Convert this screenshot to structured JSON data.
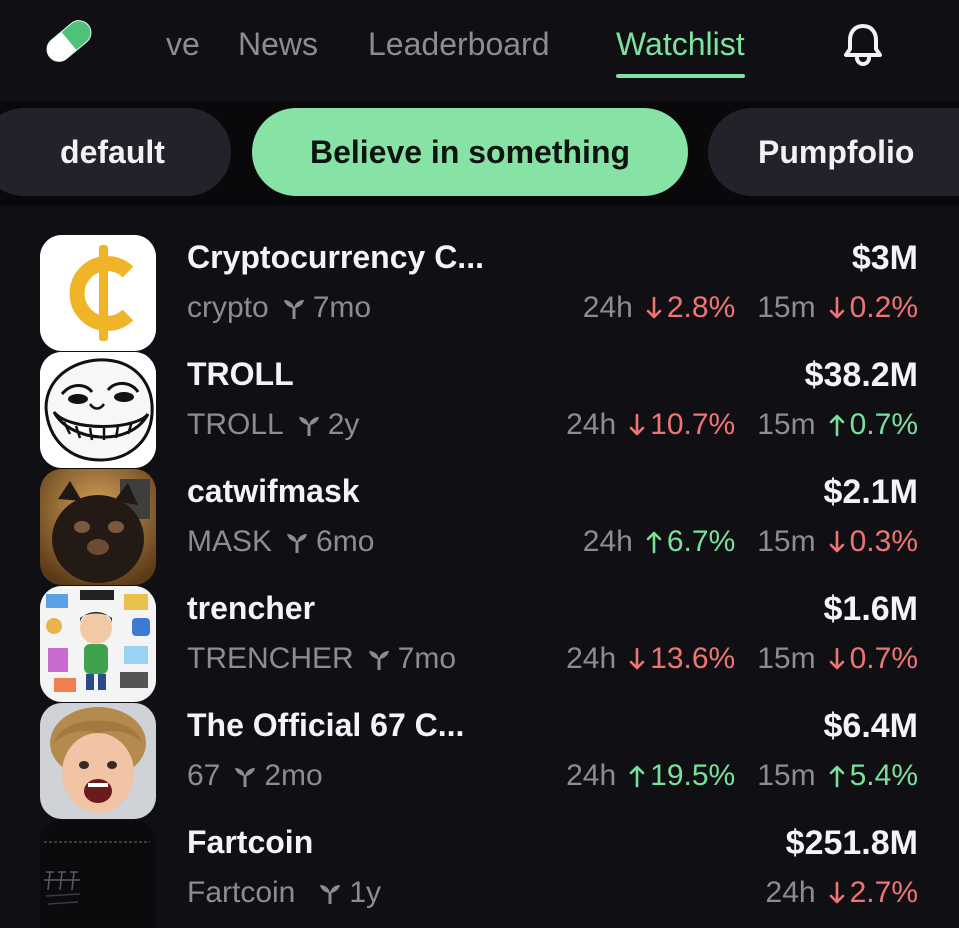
{
  "nav": {
    "tabs": [
      {
        "label": "ve"
      },
      {
        "label": "News"
      },
      {
        "label": "Leaderboard"
      },
      {
        "label": "Watchlist",
        "active": true
      }
    ]
  },
  "lists": {
    "pills": [
      {
        "label": "default"
      },
      {
        "label": "Believe in something",
        "active": true
      },
      {
        "label": "Pumpfolio"
      }
    ]
  },
  "coins": [
    {
      "name": "Cryptocurrency C...",
      "ticker": "crypto",
      "age": "7mo",
      "market_cap": "$3M",
      "change_24h": {
        "label": "24h",
        "value": "2.8%",
        "direction": "down"
      },
      "change_15m": {
        "label": "15m",
        "value": "0.2%",
        "direction": "down"
      },
      "avatar": "bitcoin-cent-logo"
    },
    {
      "name": "TROLL",
      "ticker": "TROLL",
      "age": "2y",
      "market_cap": "$38.2M",
      "change_24h": {
        "label": "24h",
        "value": "10.7%",
        "direction": "down"
      },
      "change_15m": {
        "label": "15m",
        "value": "0.7%",
        "direction": "up"
      },
      "avatar": "trollface"
    },
    {
      "name": "catwifmask",
      "ticker": "MASK",
      "age": "6mo",
      "market_cap": "$2.1M",
      "change_24h": {
        "label": "24h",
        "value": "6.7%",
        "direction": "up"
      },
      "change_15m": {
        "label": "15m",
        "value": "0.3%",
        "direction": "down"
      },
      "avatar": "cat-with-mask-photo"
    },
    {
      "name": "trencher",
      "ticker": "TRENCHER",
      "age": "7mo",
      "market_cap": "$1.6M",
      "change_24h": {
        "label": "24h",
        "value": "13.6%",
        "direction": "down"
      },
      "change_15m": {
        "label": "15m",
        "value": "0.7%",
        "direction": "down"
      },
      "avatar": "cartoon-trencher"
    },
    {
      "name": "The Official 67 C...",
      "ticker": "67",
      "age": "2mo",
      "market_cap": "$6.4M",
      "change_24h": {
        "label": "24h",
        "value": "19.5%",
        "direction": "up"
      },
      "change_15m": {
        "label": "15m",
        "value": "5.4%",
        "direction": "up"
      },
      "avatar": "kid-photo"
    },
    {
      "name": "Fartcoin",
      "ticker": "Fartcoin",
      "age": "1y",
      "market_cap": "$251.8M",
      "change_24h": {
        "label": "24h",
        "value": "2.7%",
        "direction": "down"
      },
      "avatar": "fartcoin-text-logo"
    }
  ],
  "colors": {
    "background": "#101014",
    "accent_green": "#7ee2a1",
    "pill_active": "#86e3a5",
    "down_red": "#f07474",
    "up_green": "#79e09c",
    "muted_text": "#8b8c94"
  },
  "icons": {
    "logo": "pill-capsule-icon",
    "bell": "notification-bell-icon",
    "age": "sprout-icon",
    "down": "arrow-down-icon",
    "up": "arrow-up-icon"
  }
}
